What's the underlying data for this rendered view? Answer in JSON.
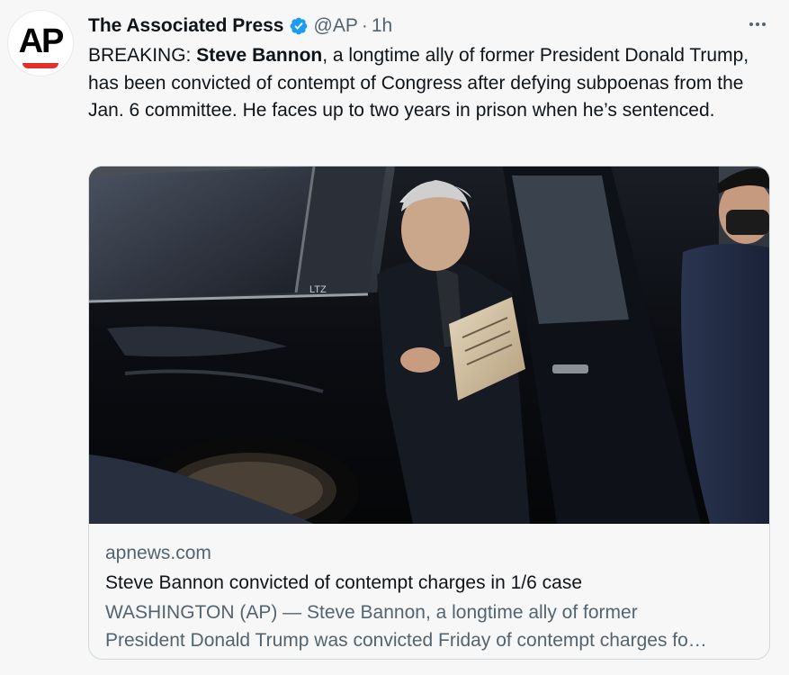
{
  "author": {
    "display_name": "The Associated Press",
    "handle": "@AP",
    "separator": "·",
    "time": "1h",
    "avatar_text": "AP",
    "verified_icon": "verified-badge-icon",
    "verified_color": "#1d9bf0"
  },
  "more_icon": "more-dots-icon",
  "tweet": {
    "prefix": "BREAKING: ",
    "bold_name": "Steve Bannon",
    "rest": ", a longtime ally of former President Donald Trump, has been convicted of contempt of Congress after defying subpoenas from the Jan. 6 committee. He faces up to two years in prison when he’s sentenced."
  },
  "card": {
    "domain": "apnews.com",
    "title": "Steve Bannon convicted of contempt charges in 1/6 case",
    "description_line1": "WASHINGTON (AP) — Steve Bannon, a longtime ally of former",
    "description_line2": "President Donald Trump was convicted Friday of contempt charges fo…",
    "image_plate_text": "LTZ"
  },
  "colors": {
    "background": "#f7f7f7",
    "text_primary": "#0f1419",
    "text_secondary": "#536471",
    "card_border": "#cfd9de",
    "ap_red": "#e5302a"
  }
}
